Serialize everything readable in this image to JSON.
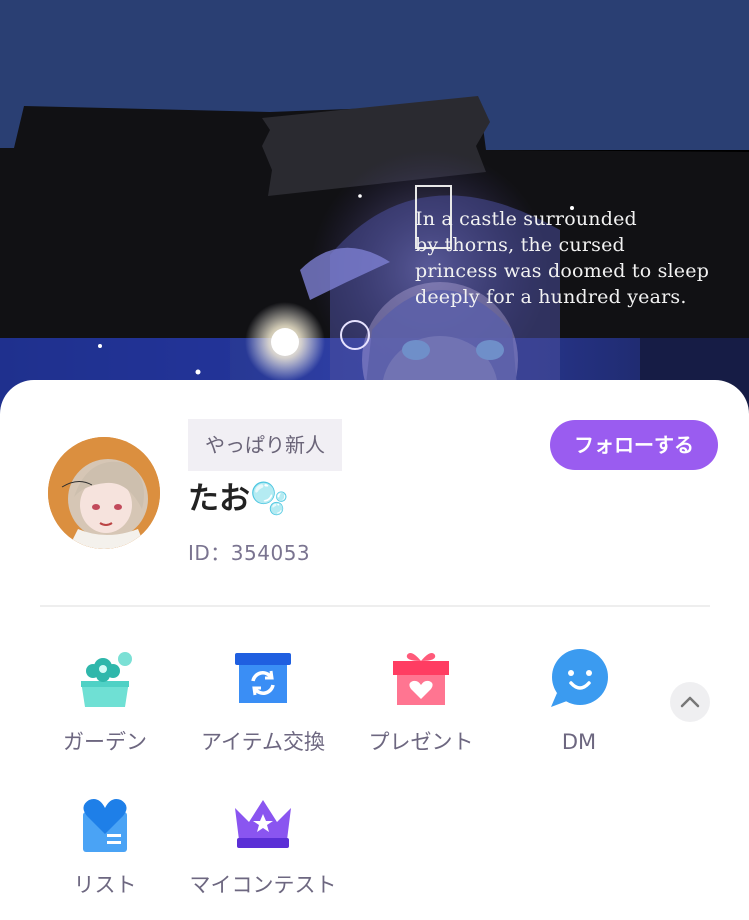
{
  "banner": {
    "caption": "In a castle surrounded\n   by thorns, the cursed\nprincess was doomed to sleep\ndeeply for a hundred years."
  },
  "profile": {
    "rank": "やっぱり新人",
    "username": "たお🫧",
    "user_id": "ID：354053",
    "follow_label": "フォローする"
  },
  "menu": {
    "items": [
      {
        "label": "ガーデン",
        "icon": "garden-icon"
      },
      {
        "label": "アイテム交換",
        "icon": "item-exchange-icon"
      },
      {
        "label": "プレゼント",
        "icon": "present-icon"
      },
      {
        "label": "DM",
        "icon": "dm-icon"
      },
      {
        "label": "リスト",
        "icon": "list-icon"
      },
      {
        "label": "マイコンテスト",
        "icon": "my-contest-icon"
      }
    ],
    "collapse_icon": "chevron-up-icon"
  },
  "colors": {
    "accent": "#9a5cf0",
    "garden": "#4fd1c5",
    "exchange": "#2c8cf2",
    "present": "#ff5a7a",
    "dm": "#3b9bf0",
    "list": "#3b9bf0",
    "contest": "#8a55f0"
  }
}
